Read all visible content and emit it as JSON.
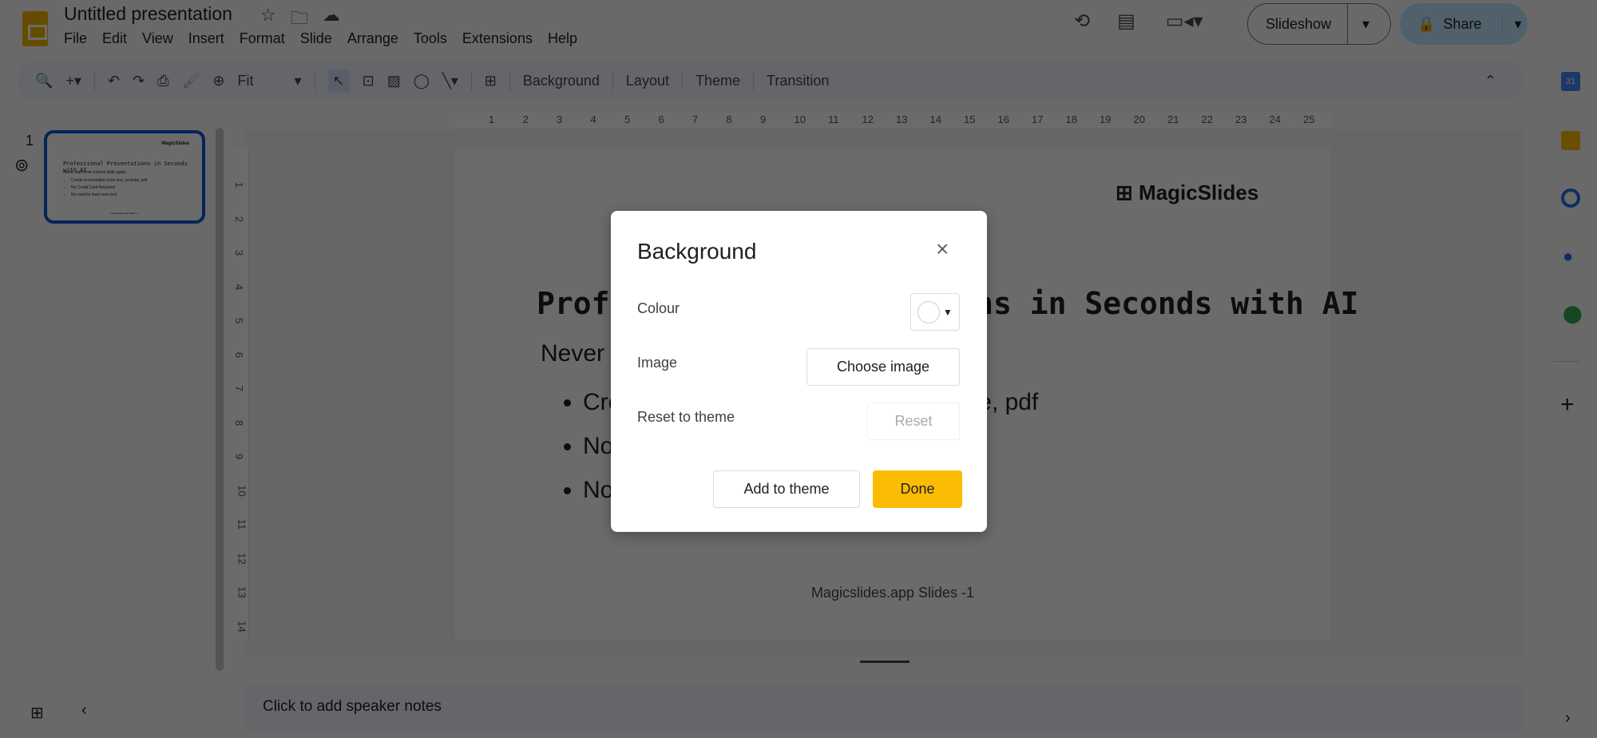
{
  "app": {
    "title": "Untitled presentation",
    "menu": [
      "File",
      "Edit",
      "View",
      "Insert",
      "Format",
      "Slide",
      "Arrange",
      "Tools",
      "Extensions",
      "Help"
    ],
    "slideshow_label": "Slideshow",
    "share_label": "Share",
    "brand_color": "#f4b400"
  },
  "toolbar": {
    "zoom_value": "Fit",
    "background": "Background",
    "layout": "Layout",
    "theme": "Theme",
    "transition": "Transition"
  },
  "filmstrip": {
    "slide_number": "1"
  },
  "ruler": {
    "top_ticks": [
      "1",
      "2",
      "3",
      "4",
      "5",
      "6",
      "7",
      "8",
      "9",
      "10",
      "11",
      "12",
      "13",
      "14",
      "15",
      "16",
      "17",
      "18",
      "19",
      "20",
      "21",
      "22",
      "23",
      "24",
      "25"
    ],
    "left_ticks": [
      "1",
      "2",
      "3",
      "4",
      "5",
      "6",
      "7",
      "8",
      "9",
      "10",
      "11",
      "12",
      "13",
      "14"
    ]
  },
  "slide": {
    "logo_text": "MagicSlides",
    "title": "Professional Presentations in Seconds with AI",
    "subtitle": "Never start from a blank slide again.",
    "bullets": [
      "Create presentation from text, youtube, pdf",
      "No Credit Card Required",
      "No need to learn new tool"
    ],
    "footer": "Magicslides.app Slides -1"
  },
  "notes": {
    "placeholder": "Click to add speaker notes"
  },
  "dialog": {
    "title": "Background",
    "colour_label": "Colour",
    "image_label": "Image",
    "choose_image": "Choose image",
    "reset_label": "Reset to theme",
    "reset_button": "Reset",
    "add_to_theme": "Add to theme",
    "done": "Done",
    "done_color": "#fbbc04"
  }
}
